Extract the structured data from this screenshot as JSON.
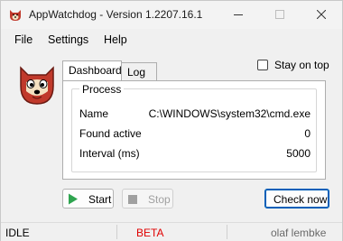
{
  "window": {
    "title": "AppWatchdog - Version 1.2207.16.1"
  },
  "menu": [
    "File",
    "Settings",
    "Help"
  ],
  "tabs": [
    {
      "label": "Dashboard",
      "active": true
    },
    {
      "label": "Log",
      "active": false
    }
  ],
  "stay_on_top": {
    "label": "Stay on top",
    "checked": false
  },
  "process_group": {
    "title": "Process",
    "rows": [
      {
        "label": "Name",
        "value": "C:\\WINDOWS\\system32\\cmd.exe"
      },
      {
        "label": "Found active",
        "value": "0"
      },
      {
        "label": "Interval (ms)",
        "value": "5000"
      }
    ]
  },
  "buttons": {
    "start": "Start",
    "stop": "Stop",
    "check_now": "Check now"
  },
  "status": {
    "state": "IDLE",
    "channel": "BETA",
    "author": "olaf lembke"
  },
  "colors": {
    "beta": "#e00000",
    "accent": "#005fb8",
    "start_icon": "#2ea44f",
    "logo": "#c0392b"
  },
  "icons": [
    "app-icon",
    "minimize-icon",
    "maximize-icon",
    "close-icon",
    "dog-logo-icon",
    "play-icon",
    "stop-icon"
  ]
}
